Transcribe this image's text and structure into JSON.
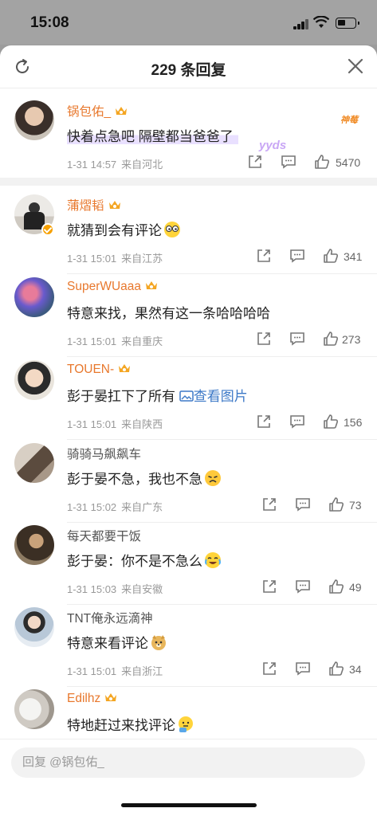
{
  "status_bar": {
    "time": "15:08"
  },
  "header": {
    "title": "229 条回复"
  },
  "op": {
    "name": "锅包佑_",
    "badge": "神莓",
    "text": "快着点急吧 隔壁都当爸爸了",
    "sticker": "yyds",
    "time": "1-31 14:57",
    "location": "来自河北",
    "likes": "5470"
  },
  "comments": [
    {
      "name": "蒲熠韬",
      "text": "就猜到会有评论",
      "time": "1-31 15:01",
      "location": "来自江苏",
      "likes": "341"
    },
    {
      "name": "SuperWUaaa",
      "text": "特意来找，果然有这一条哈哈哈哈",
      "time": "1-31 15:01",
      "location": "来自重庆",
      "likes": "273"
    },
    {
      "name": "TOUEN-",
      "text": "彭于晏扛下了所有",
      "link": "查看图片",
      "time": "1-31 15:01",
      "location": "来自陕西",
      "likes": "156"
    },
    {
      "name": "骑骑马飙飙车",
      "text": "彭于晏不急，我也不急",
      "time": "1-31 15:02",
      "location": "来自广东",
      "likes": "73"
    },
    {
      "name": "每天都要干饭",
      "text": "彭于晏：你不是不急么",
      "time": "1-31 15:03",
      "location": "来自安徽",
      "likes": "49"
    },
    {
      "name": "TNT俺永远滴神",
      "text": "特意来看评论",
      "time": "1-31 15:01",
      "location": "来自浙江",
      "likes": "34"
    },
    {
      "name": "Edilhz",
      "text": "特地赶过来找评论"
    }
  ],
  "reply_bar": {
    "placeholder": "回复 @锅包佑_"
  }
}
